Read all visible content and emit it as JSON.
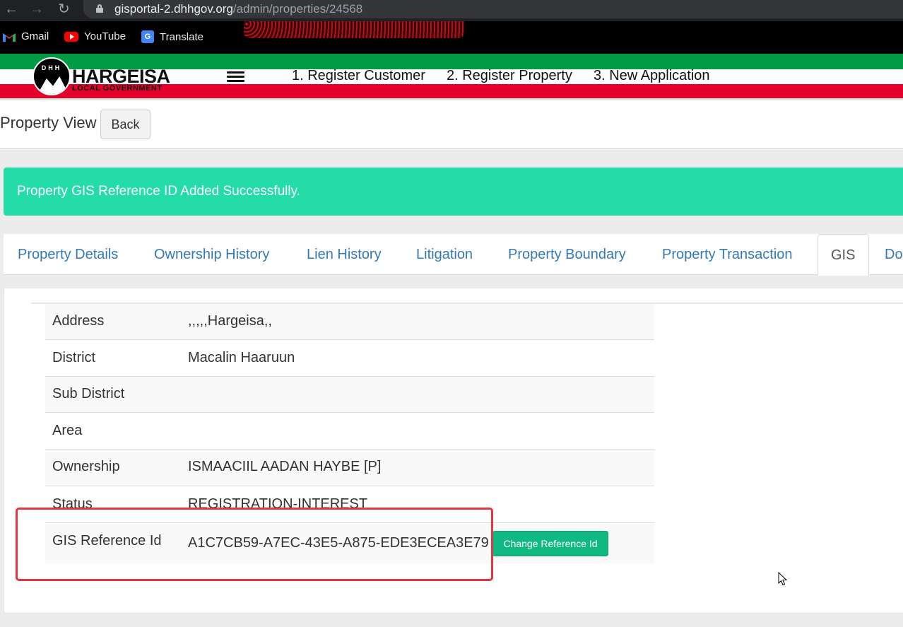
{
  "browser": {
    "url_host": "gisportal-2.dhhgov.org",
    "url_path": "/admin/properties/24568",
    "bookmarks": [
      {
        "label": "Gmail",
        "icon": "gmail-icon"
      },
      {
        "label": "YouTube",
        "icon": "youtube-icon"
      },
      {
        "label": "Translate",
        "icon": "translate-icon"
      }
    ]
  },
  "header": {
    "logo_letters": "DHH",
    "logo_title": "HARGEISA",
    "logo_subtitle": "LOCAL GOVERNMENT",
    "nav": [
      "1. Register Customer",
      "2. Register Property",
      "3. New Application"
    ],
    "colors": {
      "green": "#009a44",
      "white": "#ffffff",
      "red": "#e4002b"
    }
  },
  "page": {
    "title": "Property View",
    "back_label": "Back"
  },
  "alert": {
    "message": "Property GIS Reference ID Added Successfully.",
    "color": "#23dcaa"
  },
  "tabs": {
    "items": [
      "Property Details",
      "Ownership History",
      "Lien History",
      "Litigation",
      "Property Boundary",
      "Property Transaction",
      "GIS",
      "Do"
    ],
    "active": "GIS"
  },
  "details": {
    "rows": [
      {
        "label": "Address",
        "value": ",,,,,Hargeisa,,"
      },
      {
        "label": "District",
        "value": "Macalin Haaruun"
      },
      {
        "label": "Sub District",
        "value": ""
      },
      {
        "label": "Area",
        "value": ""
      },
      {
        "label": "Ownership",
        "value": "ISMAACIIL AADAN HAYBE [P]"
      },
      {
        "label": "Status",
        "value": "REGISTRATION-INTEREST"
      },
      {
        "label": "GIS Reference Id",
        "value": "A1C7CB59-A7EC-43E5-A875-EDE3ECEA3E79"
      }
    ],
    "change_button_label": "Change Reference Id"
  }
}
